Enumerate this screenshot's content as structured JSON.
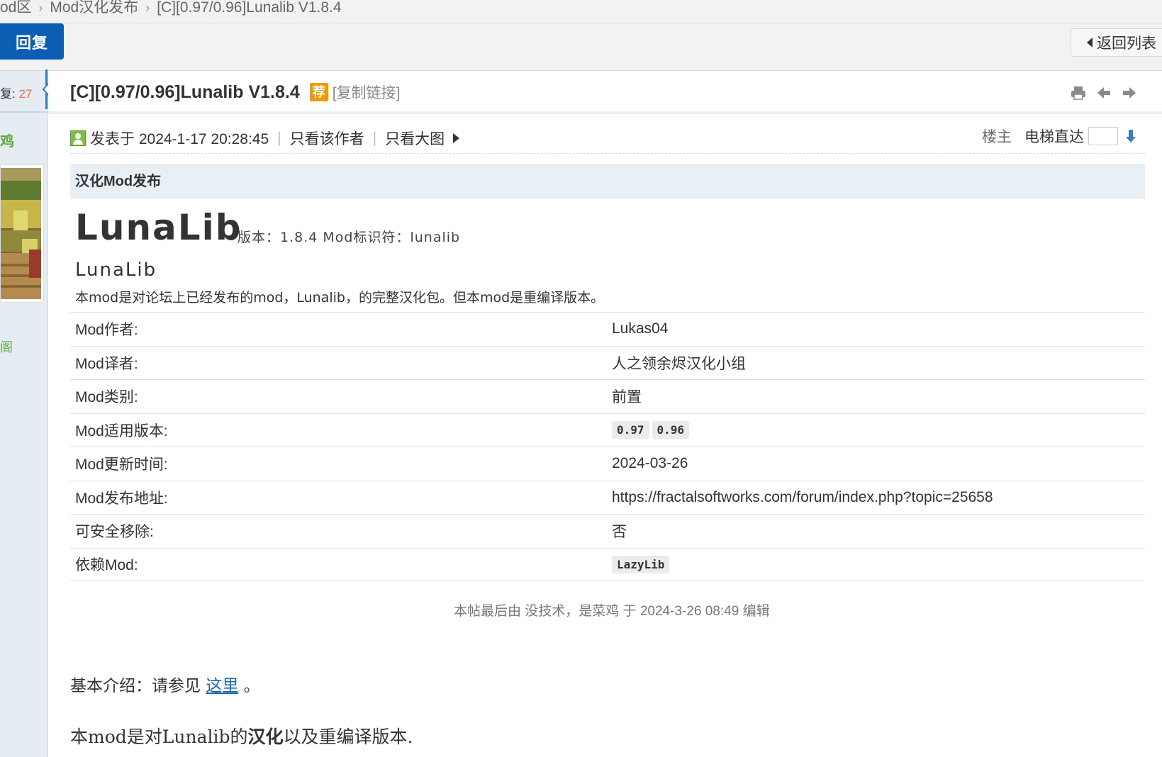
{
  "breadcrumb": {
    "items": [
      "od区",
      "Mod汉化发布",
      "[C][0.97/0.96]Lunalib V1.8.4"
    ],
    "separator": "›"
  },
  "toolbar": {
    "reply_label": "回复",
    "back_label": "返回列表"
  },
  "sidebar": {
    "reply_prefix": "复:",
    "reply_count": "27",
    "user_name": "鸡",
    "user_extra": "阁"
  },
  "thread": {
    "title": "[C][0.97/0.96]Lunalib V1.8.4",
    "recommend_badge": "荐",
    "copy_link": "[复制链接]"
  },
  "post_meta": {
    "posted": "发表于 2024-1-17 20:28:45",
    "only_author": "只看该作者",
    "only_images": "只看大图",
    "floor": "楼主",
    "elevator": "电梯直达"
  },
  "content": {
    "section_title": "汉化Mod发布",
    "mod_name": "LunaLib",
    "version_line": "版本：1.8.4 Mod标识符：lunalib",
    "mod_name_small": "LunaLib",
    "description": "本mod是对论坛上已经发布的mod，Lunalib，的完整汉化包。但本mod是重编译版本。",
    "table": [
      {
        "key": "Mod作者:",
        "value": "Lukas04"
      },
      {
        "key": "Mod译者:",
        "value": "人之领余烬汉化小组"
      },
      {
        "key": "Mod类别:",
        "value": "前置"
      },
      {
        "key": "Mod适用版本:",
        "tags": [
          "0.97",
          "0.96"
        ]
      },
      {
        "key": "Mod更新时间:",
        "value": "2024-03-26"
      },
      {
        "key": "Mod发布地址:",
        "value": "https://fractalsoftworks.com/forum/index.php?topic=25658"
      },
      {
        "key": "可安全移除:",
        "value": "否"
      },
      {
        "key": "依赖Mod:",
        "tags": [
          "LazyLib"
        ]
      }
    ],
    "edit_note": "本帖最后由 没技术，是菜鸡 于 2024-3-26 08:49 编辑",
    "intro_prefix": "基本介绍：请参见",
    "intro_link": "这里",
    "intro_suffix": "。",
    "body_part1": "本mod是对Lunalib的",
    "body_bold": "汉化",
    "body_part2": "以及重编译版本."
  },
  "colors": {
    "primary_blue": "#0a5fb4",
    "badge_orange": "#f39800",
    "user_green": "#63a93d",
    "reply_count_red": "#f26c4f"
  },
  "icons": [
    "print-icon",
    "prev-thread-icon",
    "next-thread-icon",
    "online-user-icon",
    "elevator-go-icon"
  ]
}
